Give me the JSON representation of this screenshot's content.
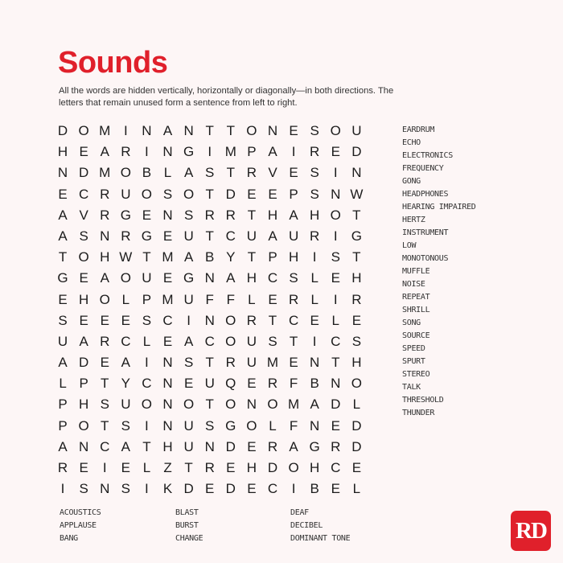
{
  "title": "Sounds",
  "instructions": "All the words are hidden vertically, horizontally or diagonally—in both directions. The letters that remain unused form a sentence from left to right.",
  "grid_rows": [
    "DOMINANTTONESOU",
    "HEARINGIMPAIRED",
    "NDMOBLASTRVESIN",
    "ECRUOSOTDEEPSNW",
    "AVRGENSRRTHAHOT",
    "ASNRGEUTCUAURIG",
    "TOHWTMABYTPHIST",
    "GEAOUEGNAHCSLEH",
    "EHOLPMUFFLERLIR",
    "SEEESCINORTCELE",
    "UARCLEACOUSTICS",
    "ADEAINSTRUMENTH",
    "LPTYCNEUQERFBNO",
    "PHSUONOTONOMADL",
    "POTSINUSGOLFNED",
    "ANCATHUNDERAGRD",
    "REIELZTREHDOHCE",
    "ISNSIKDEDECIBEL"
  ],
  "word_list_right": [
    "EARDRUM",
    "ECHO",
    "ELECTRONICS",
    "FREQUENCY",
    "GONG",
    "HEADPHONES",
    "HEARING IMPAIRED",
    "HERTZ",
    "INSTRUMENT",
    "LOW",
    "MONOTONOUS",
    "MUFFLE",
    "NOISE",
    "REPEAT",
    "SHRILL",
    "SONG",
    "SOURCE",
    "SPEED",
    "SPURT",
    "STEREO",
    "TALK",
    "THRESHOLD",
    "THUNDER"
  ],
  "word_list_bottom": [
    [
      "ACOUSTICS",
      "APPLAUSE",
      "BANG"
    ],
    [
      "BLAST",
      "BURST",
      "CHANGE"
    ],
    [
      "DEAF",
      "DECIBEL",
      "DOMINANT TONE"
    ]
  ],
  "logo_text": "RD",
  "colors": {
    "background": "#fdf6f6",
    "title": "#e0202b",
    "logo": "#e0202b"
  }
}
